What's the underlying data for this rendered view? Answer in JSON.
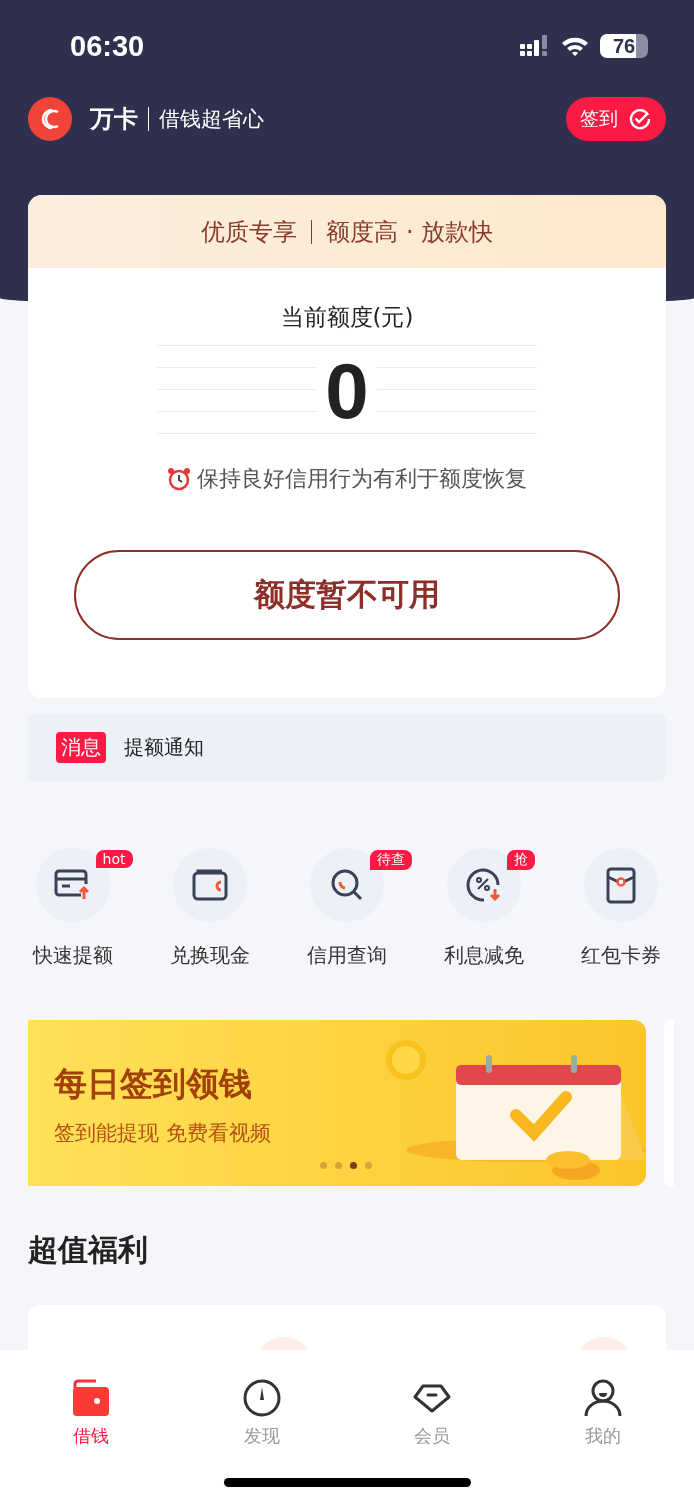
{
  "status_bar": {
    "time": "06:30",
    "battery": "76"
  },
  "header": {
    "brand": "万卡",
    "slogan": "借钱超省心",
    "checkin_button": "签到"
  },
  "credit_card": {
    "banner": "优质专享",
    "banner_tagline": "额度高 · 放款快",
    "label": "当前额度(元)",
    "amount": "0",
    "hint": "保持良好信用行为有利于额度恢复",
    "button": "额度暂不可用"
  },
  "notice": {
    "tag": "消息",
    "text": "提额通知"
  },
  "shortcuts": [
    {
      "kind": "card-up",
      "label": "快速提额",
      "badge": "hot"
    },
    {
      "kind": "wallet",
      "label": "兑换现金"
    },
    {
      "kind": "search",
      "label": "信用查询",
      "badge": "待查"
    },
    {
      "kind": "discount",
      "label": "利息减免",
      "badge": "抢"
    },
    {
      "kind": "envelope",
      "label": "红包卡券"
    }
  ],
  "promo_banner": {
    "title": "每日签到领钱",
    "subtitle": "签到能提现 免费看视频",
    "dots": [
      {
        "selected": false
      },
      {
        "selected": false
      },
      {
        "selected": true
      },
      {
        "selected": false
      }
    ]
  },
  "section_title": "超值福利",
  "tab_bar": [
    {
      "kind": "wallet",
      "label": "借钱",
      "selected": true
    },
    {
      "kind": "compass",
      "label": "发现",
      "selected": false
    },
    {
      "kind": "gem",
      "label": "会员",
      "selected": false
    },
    {
      "kind": "person",
      "label": "我的",
      "selected": false
    }
  ]
}
